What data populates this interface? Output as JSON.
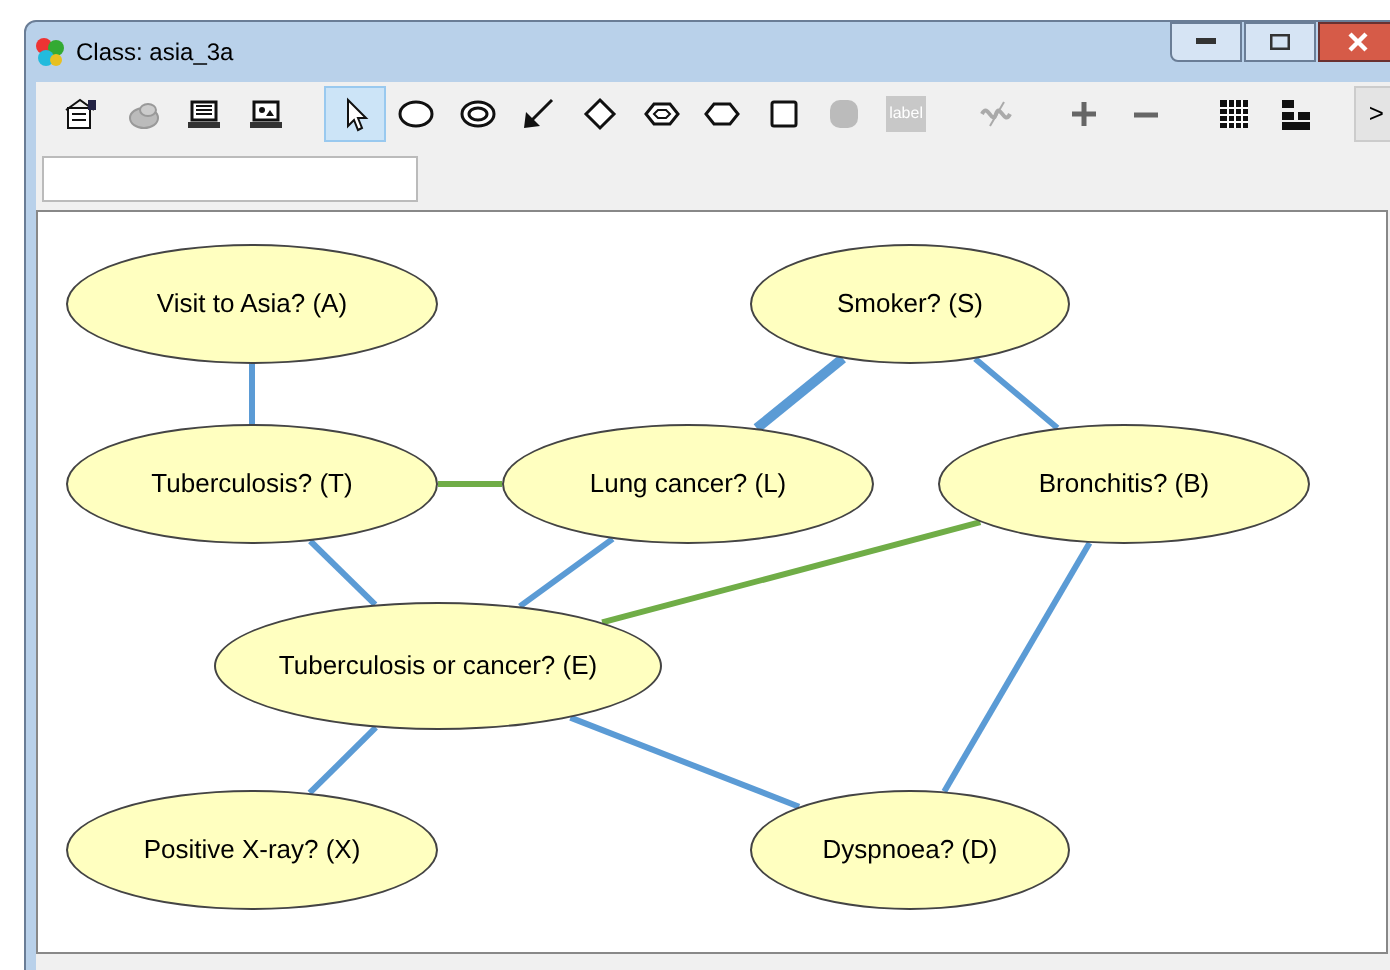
{
  "window": {
    "title": "Class: asia_3a"
  },
  "toolbar": [
    {
      "kind": "properties",
      "disabled": false,
      "selected": false
    },
    {
      "kind": "cloud",
      "disabled": true,
      "selected": false
    },
    {
      "kind": "laptop",
      "disabled": false,
      "selected": false
    },
    {
      "kind": "laptop-image",
      "disabled": false,
      "selected": false
    },
    {
      "kind": "pointer",
      "disabled": false,
      "selected": true
    },
    {
      "kind": "ellipse",
      "disabled": false,
      "selected": false
    },
    {
      "kind": "double-ellipse",
      "disabled": false,
      "selected": false
    },
    {
      "kind": "arrow",
      "disabled": false,
      "selected": false
    },
    {
      "kind": "diamond",
      "disabled": false,
      "selected": false
    },
    {
      "kind": "double-hexagon",
      "disabled": false,
      "selected": false
    },
    {
      "kind": "hexagon",
      "disabled": false,
      "selected": false
    },
    {
      "kind": "square",
      "disabled": false,
      "selected": false
    },
    {
      "kind": "rounded",
      "disabled": true,
      "selected": false
    },
    {
      "kind": "label",
      "text": "label",
      "disabled": true,
      "selected": false
    },
    {
      "kind": "wave",
      "disabled": true,
      "selected": false
    },
    {
      "kind": "plus",
      "disabled": false,
      "selected": false
    },
    {
      "kind": "minus",
      "disabled": false,
      "selected": false
    },
    {
      "kind": "table",
      "disabled": false,
      "selected": false
    },
    {
      "kind": "tree",
      "disabled": false,
      "selected": false
    }
  ],
  "more_button": ">",
  "nodes": [
    {
      "label": "Visit to Asia? (A)"
    },
    {
      "label": "Smoker? (S)"
    },
    {
      "label": "Tuberculosis? (T)"
    },
    {
      "label": "Lung cancer? (L)"
    },
    {
      "label": "Bronchitis? (B)"
    },
    {
      "label": "Tuberculosis or cancer? (E)"
    },
    {
      "label": "Positive X-ray? (X)"
    },
    {
      "label": "Dyspnoea? (D)"
    }
  ],
  "edges": [
    {
      "color": "#5b9bd5",
      "kind": "normal"
    },
    {
      "color": "#70ad47",
      "kind": "normal"
    },
    {
      "color": "#5b9bd5",
      "kind": "thick"
    },
    {
      "color": "#5b9bd5",
      "kind": "normal"
    },
    {
      "color": "#5b9bd5",
      "kind": "normal"
    },
    {
      "color": "#5b9bd5",
      "kind": "normal"
    },
    {
      "color": "#70ad47",
      "kind": "normal"
    },
    {
      "color": "#5b9bd5",
      "kind": "normal"
    },
    {
      "color": "#5b9bd5",
      "kind": "normal"
    },
    {
      "color": "#5b9bd5",
      "kind": "normal"
    }
  ]
}
